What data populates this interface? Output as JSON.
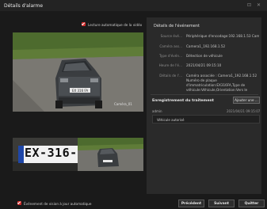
{
  "window": {
    "title": "Détails d'alarme",
    "restore_glyph": "⊡",
    "close_glyph": "✕"
  },
  "auto_play": {
    "label": "Lecture automatique de la vidéo",
    "checked": true
  },
  "camera_overlay": "Caméra_01",
  "plate_text": "EX-316-F",
  "details": {
    "title": "Détails de l'événement",
    "rows": [
      {
        "key": "Source évé...",
        "value": "Périphérique d'encodage:192.168.1.53 Cam..."
      },
      {
        "key": "Caméra ass...",
        "value": "Camera1_192.168.1.52"
      },
      {
        "key": "Type d'évén...",
        "value": "Détection de véhicule"
      },
      {
        "key": "Heure de l'é...",
        "value": "2021/04/21 09:15:10"
      },
      {
        "key": "Détails de l'...",
        "value": "Caméra associée : Camera1_192.168.1.52",
        "value2": "Numéro de plaque",
        "value3": "d'immatriculation:EX316FA,Type de",
        "value4": "véhicule:Véhicule,Orientation:Vers le"
      }
    ]
  },
  "processing": {
    "title": "Enregistrement du traitement",
    "add_label": "Ajouter une ...",
    "record_user": "admin",
    "record_time": "2021/04/21 09:15:07",
    "record_note": "Véhicule autorisé"
  },
  "auto_update": {
    "label": "Événement de vision à jour automatique",
    "checked": true
  },
  "footer": {
    "previous": "Précédent",
    "next": "Suivant",
    "quit": "Quitter"
  },
  "colors": {
    "accent": "#d02c2c",
    "background": "#1a1a1a",
    "panel": "#2a2a2a"
  }
}
